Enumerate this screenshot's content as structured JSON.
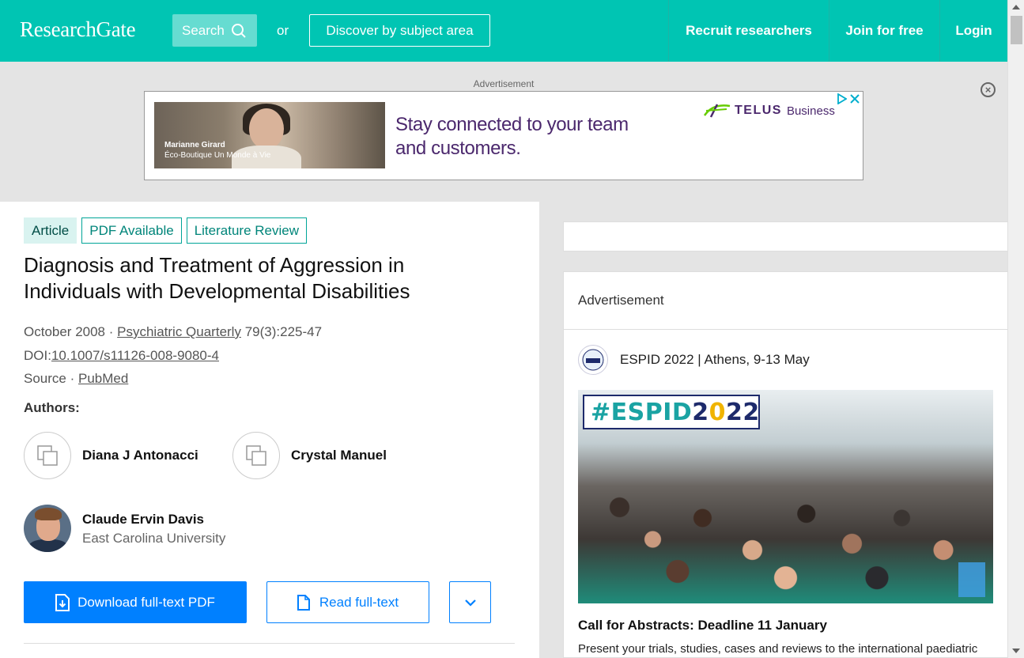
{
  "header": {
    "logo": "ResearchGate",
    "search_label": "Search",
    "or_text": "or",
    "discover_label": "Discover by subject area",
    "nav": {
      "recruit": "Recruit researchers",
      "join": "Join for free",
      "login": "Login"
    }
  },
  "top_ad": {
    "label": "Advertisement",
    "caption_name": "Marianne Girard",
    "caption_shop": "Éco-Boutique Un Monde à Vie",
    "headline": "Stay connected to your team and customers.",
    "brand": "TELUS",
    "brand_suffix": "Business"
  },
  "article": {
    "tags": [
      "Article",
      "PDF Available",
      "Literature Review"
    ],
    "title": "Diagnosis and Treatment of Aggression in Individuals with Developmental Disabilities",
    "date": "October 2008",
    "journal": "Psychiatric Quarterly",
    "issue": "79(3):225-47",
    "doi_label": "DOI:",
    "doi": "10.1007/s11126-008-9080-4",
    "source_label": "Source",
    "source": "PubMed",
    "authors_label": "Authors:",
    "authors": [
      {
        "name": "Diana J Antonacci",
        "affiliation": ""
      },
      {
        "name": "Crystal Manuel",
        "affiliation": ""
      },
      {
        "name": "Claude Ervin Davis",
        "affiliation": "East Carolina University"
      }
    ],
    "download_label": "Download full-text PDF",
    "read_label": "Read full-text"
  },
  "side_ad": {
    "label": "Advertisement",
    "advertiser": "ESPID 2022 | Athens, 9-13 May",
    "badge_prefix": "#ESPID",
    "badge_year_a": "2",
    "badge_year_b": "0",
    "badge_year_c": "22",
    "call_title": "Call for Abstracts: Deadline 11 January",
    "call_desc": "Present your trials, studies, cases and reviews to the international paediatric"
  },
  "colors": {
    "brand_teal": "#00c5b3",
    "primary_blue": "#0080ff",
    "telus_purple": "#4b286d"
  }
}
